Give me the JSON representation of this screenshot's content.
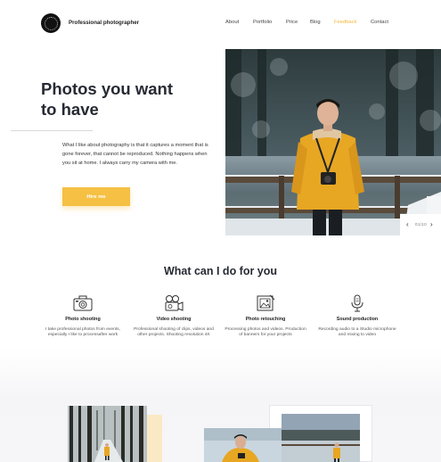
{
  "header": {
    "brand": "Professional photographer",
    "nav": [
      {
        "label": "About",
        "active": false
      },
      {
        "label": "Portfolio",
        "active": false
      },
      {
        "label": "Price",
        "active": false
      },
      {
        "label": "Blog",
        "active": false
      },
      {
        "label": "Feedback",
        "active": true
      },
      {
        "label": "Contact",
        "active": false
      }
    ]
  },
  "hero": {
    "title_line1": "Photos you want",
    "title_line2": "to have",
    "text": "What I like about photography is that it captures a moment that is gone forever, that cannot be reproduced. Nothing happens when you sit at home. I always carry my camera with me.",
    "button": "Hire me",
    "slider_counter": "01/10",
    "slider_prev_icon": "chevron-left-icon",
    "slider_next_icon": "chevron-right-icon"
  },
  "services": {
    "title": "What can I do for you",
    "items": [
      {
        "icon": "camera-icon",
        "title": "Photo shooting",
        "desc": "I take professional photos from events, especially I like to processafter work"
      },
      {
        "icon": "video-camera-icon",
        "title": "Video shooting",
        "desc": "Professional shooting of clips, videos and other projects. Shooting resolution 4K"
      },
      {
        "icon": "photo-retouch-icon",
        "title": "Photo retouching",
        "desc": "Processing photos and videos. Production of banners for your projects"
      },
      {
        "icon": "microphone-icon",
        "title": "Sound production",
        "desc": "Recording audio to a Studio microphone and mixing to video"
      }
    ]
  },
  "colors": {
    "accent": "#f5c043",
    "nav_active": "#f2b83c",
    "heading": "#262a33"
  }
}
